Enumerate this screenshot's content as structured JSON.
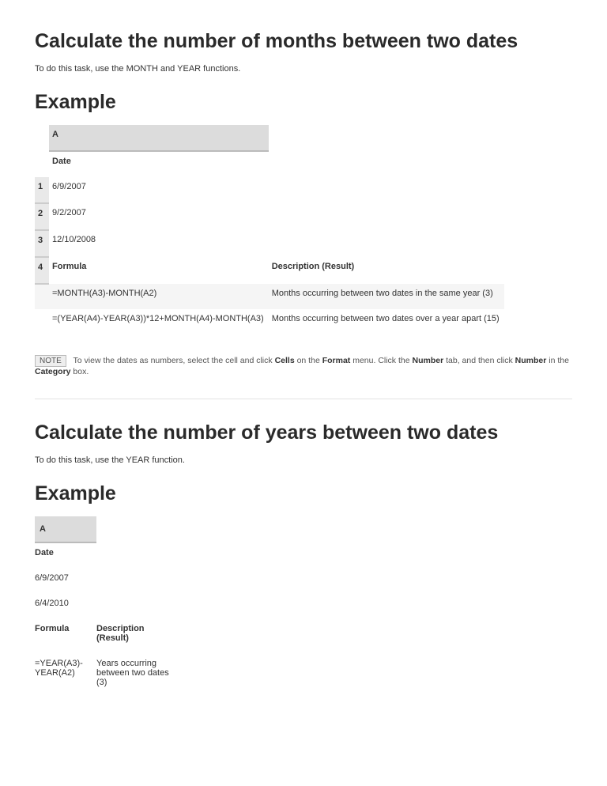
{
  "section1": {
    "title": "Calculate the number of months between two dates",
    "intro": "To do this task, use the MONTH and YEAR functions.",
    "example_heading": "Example",
    "colA": "A",
    "row_date": "Date",
    "row1_num": "1",
    "row1": "6/9/2007",
    "row2_num": "2",
    "row2": "9/2/2007",
    "row3_num": "3",
    "row3": "12/10/2008",
    "row4_num": "4",
    "formula_head": "Formula",
    "desc_head": "Description (Result)",
    "f1": "=MONTH(A3)-MONTH(A2)",
    "d1": "Months occurring between two dates in the same year (3)",
    "f2": "=(YEAR(A4)-YEAR(A3))*12+MONTH(A4)-MONTH(A3)",
    "d2": "Months occurring between two dates over a year apart (15)"
  },
  "note": {
    "badge": "NOTE",
    "pre": "To view the dates as numbers, select the cell and click ",
    "b1": "Cells",
    "mid1": " on the ",
    "b2": "Format",
    "mid2": " menu. Click the ",
    "b3": "Number",
    "mid3": " tab, and then click ",
    "b4": "Number",
    "mid4": " in the ",
    "b5": "Category",
    "post": " box."
  },
  "section2": {
    "title": "Calculate the number of years between two dates",
    "intro": "To do this task, use the YEAR function.",
    "example_heading": "Example",
    "colA": "A",
    "row_date": "Date",
    "row1": "6/9/2007",
    "row2": "6/4/2010",
    "formula_head": "Formula",
    "desc_head": "Description (Result)",
    "f1": "=YEAR(A3)-YEAR(A2)",
    "d1": "Years occurring between two dates (3)"
  }
}
